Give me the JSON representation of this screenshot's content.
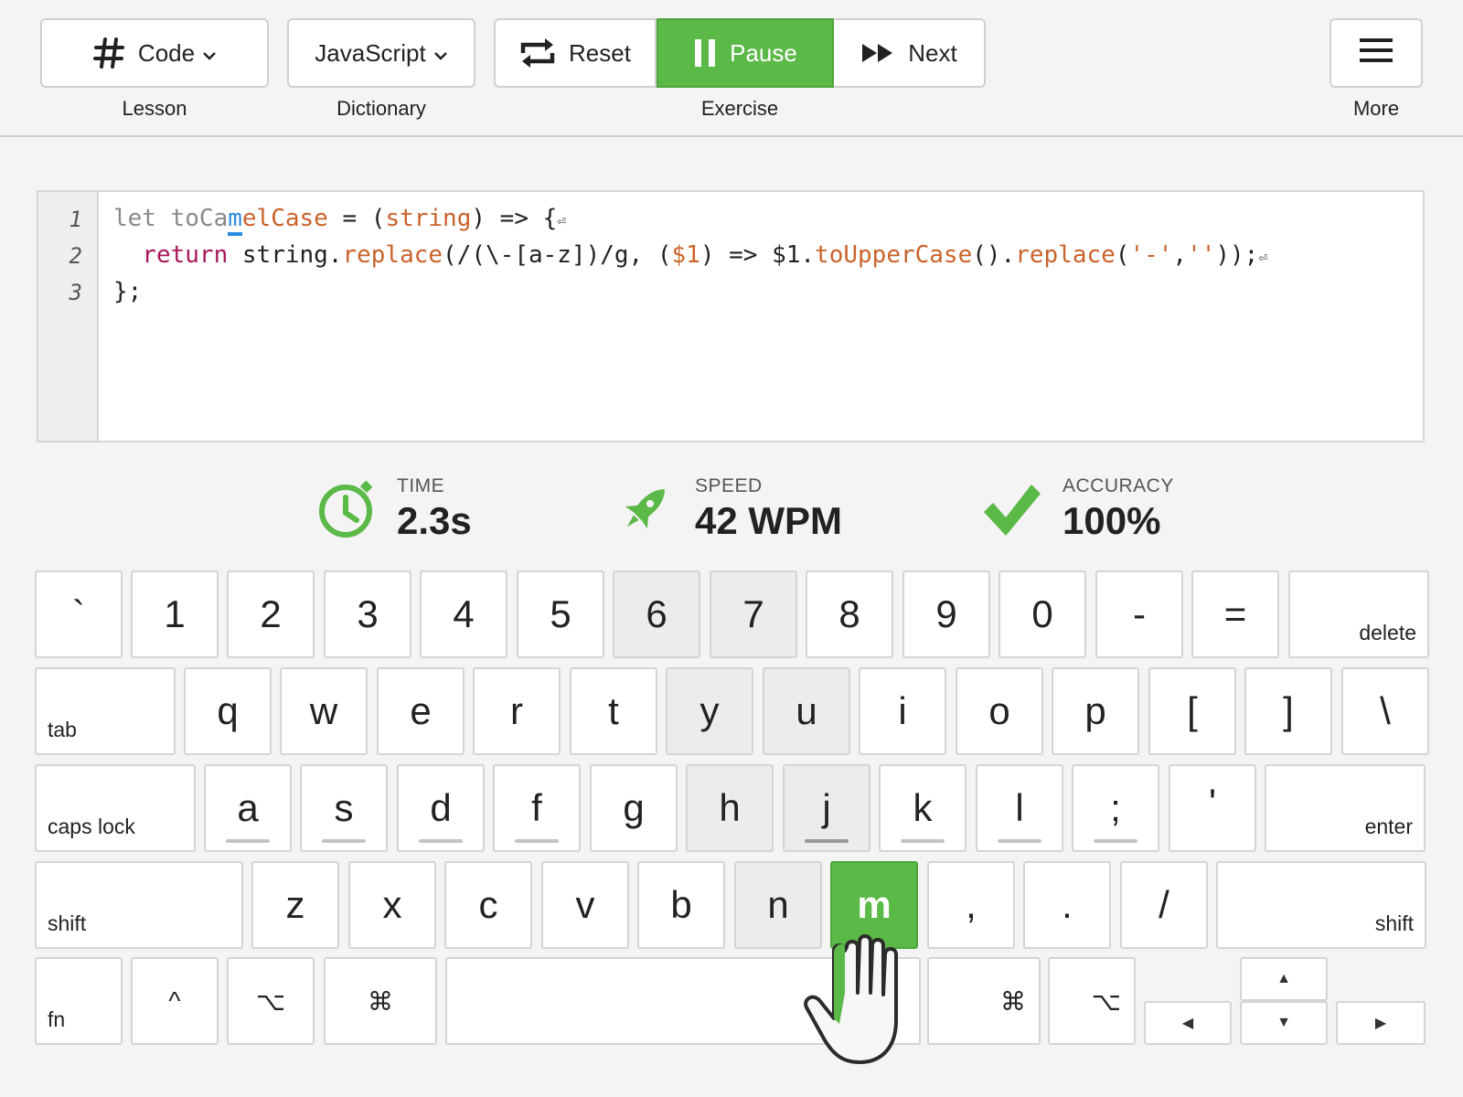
{
  "toolbar": {
    "lesson": {
      "button_label": "Code",
      "caption": "Lesson"
    },
    "dictionary": {
      "button_label": "JavaScript",
      "caption": "Dictionary"
    },
    "exercise": {
      "reset_label": "Reset",
      "pause_label": "Pause",
      "next_label": "Next",
      "caption": "Exercise"
    },
    "more": {
      "caption": "More"
    }
  },
  "editor": {
    "line_numbers": [
      "1",
      "2",
      "3"
    ],
    "line1": {
      "typed": "let toCa",
      "cursor": "m",
      "rest_a": "elCase",
      "rest_b": " = ",
      "rest_c": "(",
      "rest_d": "string",
      "rest_e": ") => {"
    },
    "line2": {
      "indent": "  ",
      "kw": "return",
      "b": " string.",
      "fn1": "replace",
      "c": "(/(\\-[a-z])/g, (",
      "p1": "$1",
      "d": ") => $1.",
      "fn2": "toUpperCase",
      "e": "().",
      "fn3": "replace",
      "f": "(",
      "s1": "'-'",
      "g": ",",
      "s2": "''",
      "h": "));"
    },
    "line3": "};",
    "newline_glyph": "⏎"
  },
  "stats": {
    "time": {
      "label": "TIME",
      "value": "2.3s"
    },
    "speed": {
      "label": "SPEED",
      "value": "42 WPM"
    },
    "accuracy": {
      "label": "ACCURACY",
      "value": "100%"
    }
  },
  "keyboard": {
    "row1": [
      "`",
      "1",
      "2",
      "3",
      "4",
      "5",
      "6",
      "7",
      "8",
      "9",
      "0",
      "-",
      "=",
      "delete"
    ],
    "row2": [
      "tab",
      "q",
      "w",
      "e",
      "r",
      "t",
      "y",
      "u",
      "i",
      "o",
      "p",
      "[",
      "]",
      "\\"
    ],
    "row3": [
      "caps lock",
      "a",
      "s",
      "d",
      "f",
      "g",
      "h",
      "j",
      "k",
      "l",
      ";",
      "'",
      "enter"
    ],
    "row4": [
      "shift",
      "z",
      "x",
      "c",
      "v",
      "b",
      "n",
      "m",
      ",",
      ".",
      "/",
      "shift"
    ],
    "row5": [
      "fn",
      "^",
      "⌥",
      "⌘",
      "",
      "⌘",
      "⌥",
      "▲",
      "◀",
      "▼",
      "▶"
    ],
    "active_key": "m",
    "highlighted_keys": [
      "6",
      "7",
      "y",
      "u",
      "h",
      "j",
      "n"
    ]
  },
  "colors": {
    "accent_green": "#5bb947",
    "cursor_blue": "#2b8be0",
    "keyword": "#a8175c",
    "function": "#c9632a"
  },
  "icons": [
    "hash-icon",
    "chevron-down-icon",
    "repeat-icon",
    "pause-icon",
    "fast-forward-icon",
    "hamburger-icon",
    "clock-icon",
    "rocket-icon",
    "checkmark-icon",
    "hand-pointer-icon"
  ]
}
